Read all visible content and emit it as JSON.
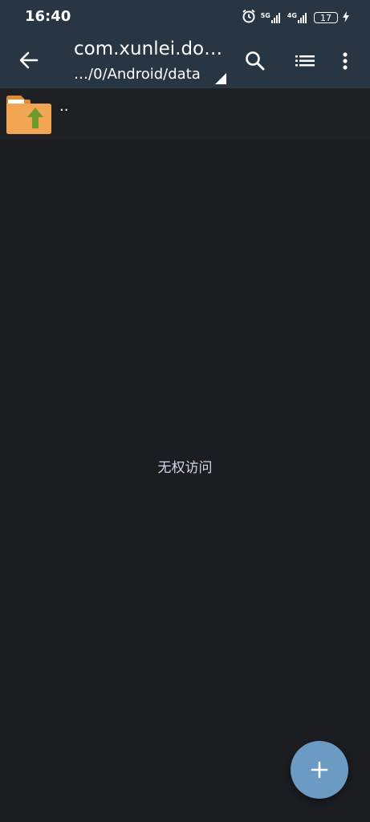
{
  "status_bar": {
    "time": "16:40",
    "network1": "5G",
    "network2": "4G",
    "battery": "17",
    "icons": [
      "alarm-icon",
      "signal-5g-icon",
      "signal-4g-icon",
      "battery-icon",
      "charging-icon"
    ]
  },
  "app_bar": {
    "title": "com.xunlei.do…",
    "path": "…/0/Android/data",
    "icons": [
      "back-arrow-icon",
      "search-icon",
      "list-view-icon",
      "more-vert-icon"
    ],
    "background": "#283543"
  },
  "files": [
    {
      "name": "..",
      "icon": "folder-up-icon"
    }
  ],
  "empty_state": {
    "text": "无权访问"
  },
  "fab": {
    "icon": "plus-icon",
    "color": "#6b9bc3"
  },
  "colors": {
    "background": "#1b1d21",
    "folder": "#f0a04b",
    "folder_arrow": "#6f9a2b"
  }
}
